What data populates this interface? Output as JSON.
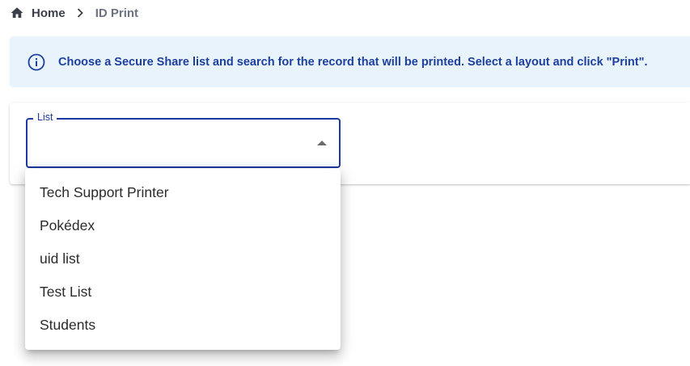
{
  "breadcrumb": {
    "home_label": "Home",
    "current_label": "ID Print"
  },
  "info": {
    "text": "Choose a Secure Share list and search for the record that will be printed. Select a layout and click \"Print\"."
  },
  "list_select": {
    "label": "List",
    "value": "",
    "options": [
      "Tech Support Printer",
      "Pokédex",
      "uid list",
      "Test List",
      "Students"
    ]
  },
  "colors": {
    "accent": "#1d3a9e",
    "info_bg": "#e8f3fc",
    "info_text": "#1d3f9e"
  },
  "icons": {
    "home": "home-icon",
    "separator": "chevron-right-icon",
    "info": "info-circle-icon",
    "dropdown": "caret-up-icon"
  }
}
